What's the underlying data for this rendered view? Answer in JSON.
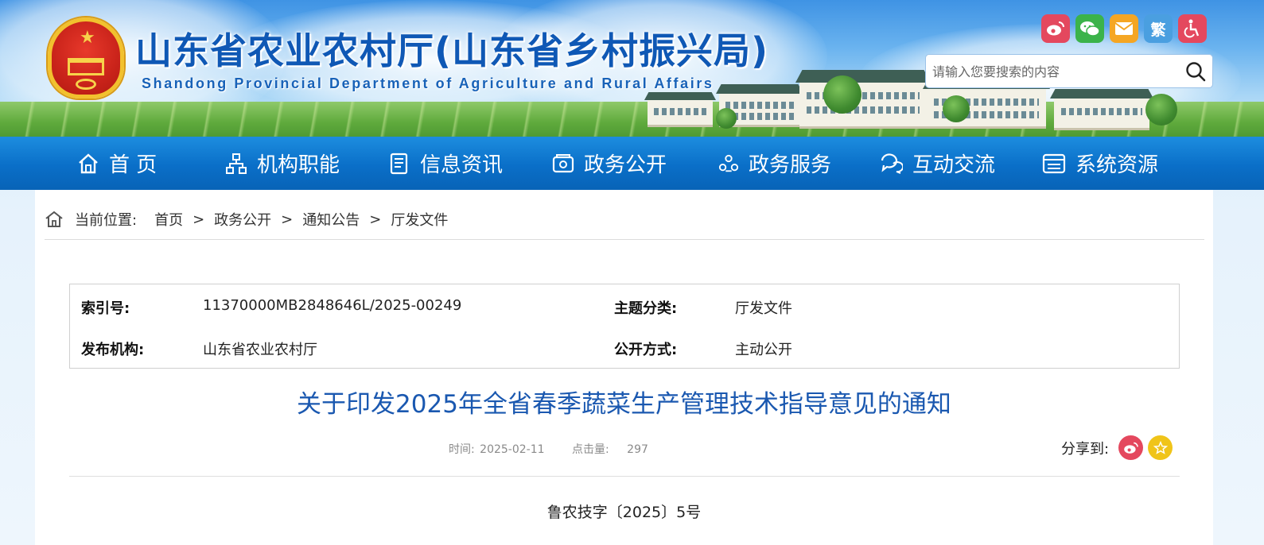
{
  "header": {
    "title": "山东省农业农村厅(山东省乡村振兴局)",
    "subtitle": "Shandong Provincial Department of Agriculture and Rural Affairs",
    "social_icons": [
      "weibo-icon",
      "wechat-icon",
      "mail-icon",
      "traditional-chinese-icon",
      "accessibility-icon"
    ],
    "social_text": {
      "traditional": "繁"
    },
    "search": {
      "placeholder": "请输入您要搜索的内容"
    }
  },
  "nav": {
    "items": [
      {
        "label": "首 页",
        "icon": "home-icon"
      },
      {
        "label": "机构职能",
        "icon": "org-chart-icon"
      },
      {
        "label": "信息资讯",
        "icon": "document-icon"
      },
      {
        "label": "政务公开",
        "icon": "inbox-icon"
      },
      {
        "label": "政务服务",
        "icon": "service-icon"
      },
      {
        "label": "互动交流",
        "icon": "chat-icon"
      },
      {
        "label": "系统资源",
        "icon": "system-icon"
      }
    ]
  },
  "breadcrumb": {
    "prefix": "当前位置:",
    "items": [
      "首页",
      "政务公开",
      "通知公告",
      "厅发文件"
    ],
    "separator": ">"
  },
  "meta": {
    "index_label": "索引号:",
    "index_value": "11370000MB2848646L/2025-00249",
    "topic_label": "主题分类:",
    "topic_value": "厅发文件",
    "publisher_label": "发布机构:",
    "publisher_value": "山东省农业农村厅",
    "disclosure_label": "公开方式:",
    "disclosure_value": "主动公开"
  },
  "article": {
    "title": "关于印发2025年全省春季蔬菜生产管理技术指导意见的通知",
    "time_label": "时间:",
    "time_value": "2025-02-11",
    "views_label": "点击量:",
    "views_value": "297",
    "share_label": "分享到:",
    "doc_number": "鲁农技字〔2025〕5号"
  },
  "colors": {
    "nav_bg": "#0a6fc8",
    "title_blue": "#1a58b0",
    "weibo": "#e4485e",
    "wechat": "#3bb34a",
    "mail": "#f5a623",
    "lang": "#4a9fe0",
    "accessibility": "#e4485e",
    "favorite": "#f0c419"
  }
}
